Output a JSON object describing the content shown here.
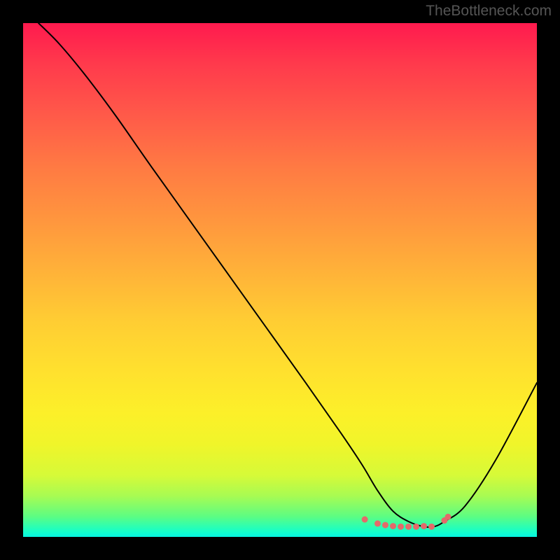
{
  "watermark": "TheBottleneck.com",
  "chart_data": {
    "type": "line",
    "title": "",
    "xlabel": "",
    "ylabel": "",
    "xlim": [
      0,
      100
    ],
    "ylim": [
      0,
      100
    ],
    "series": [
      {
        "name": "curve",
        "x": [
          3,
          7,
          12,
          18,
          25,
          35,
          45,
          55,
          62,
          66,
          69,
          72,
          75,
          78,
          80,
          82,
          86,
          92,
          100
        ],
        "y": [
          100,
          96,
          90,
          82,
          72,
          58,
          44,
          30,
          20,
          14,
          9,
          5,
          3,
          2,
          2,
          3,
          6,
          15,
          30
        ]
      }
    ],
    "markers": {
      "name": "low-region-markers",
      "color": "#e46a6a",
      "x": [
        66.5,
        69,
        70.5,
        72,
        73.5,
        75,
        76.5,
        78,
        79.5,
        82,
        82.7
      ],
      "y": [
        3.4,
        2.6,
        2.3,
        2.1,
        2.0,
        2.0,
        2.0,
        2.1,
        2.0,
        3.2,
        3.9
      ]
    },
    "gradient_stops": [
      {
        "pos": 0,
        "color": "#ff1a4e"
      },
      {
        "pos": 8,
        "color": "#ff3a4c"
      },
      {
        "pos": 18,
        "color": "#ff5a49"
      },
      {
        "pos": 28,
        "color": "#ff7a43"
      },
      {
        "pos": 38,
        "color": "#ff953e"
      },
      {
        "pos": 48,
        "color": "#ffb139"
      },
      {
        "pos": 58,
        "color": "#ffcd33"
      },
      {
        "pos": 68,
        "color": "#ffe12e"
      },
      {
        "pos": 76,
        "color": "#fcf029"
      },
      {
        "pos": 82,
        "color": "#f0f52a"
      },
      {
        "pos": 88,
        "color": "#d6fa38"
      },
      {
        "pos": 92,
        "color": "#a8fb52"
      },
      {
        "pos": 96,
        "color": "#5dfd82"
      },
      {
        "pos": 99,
        "color": "#14feca"
      },
      {
        "pos": 100,
        "color": "#07f4e1"
      }
    ]
  }
}
